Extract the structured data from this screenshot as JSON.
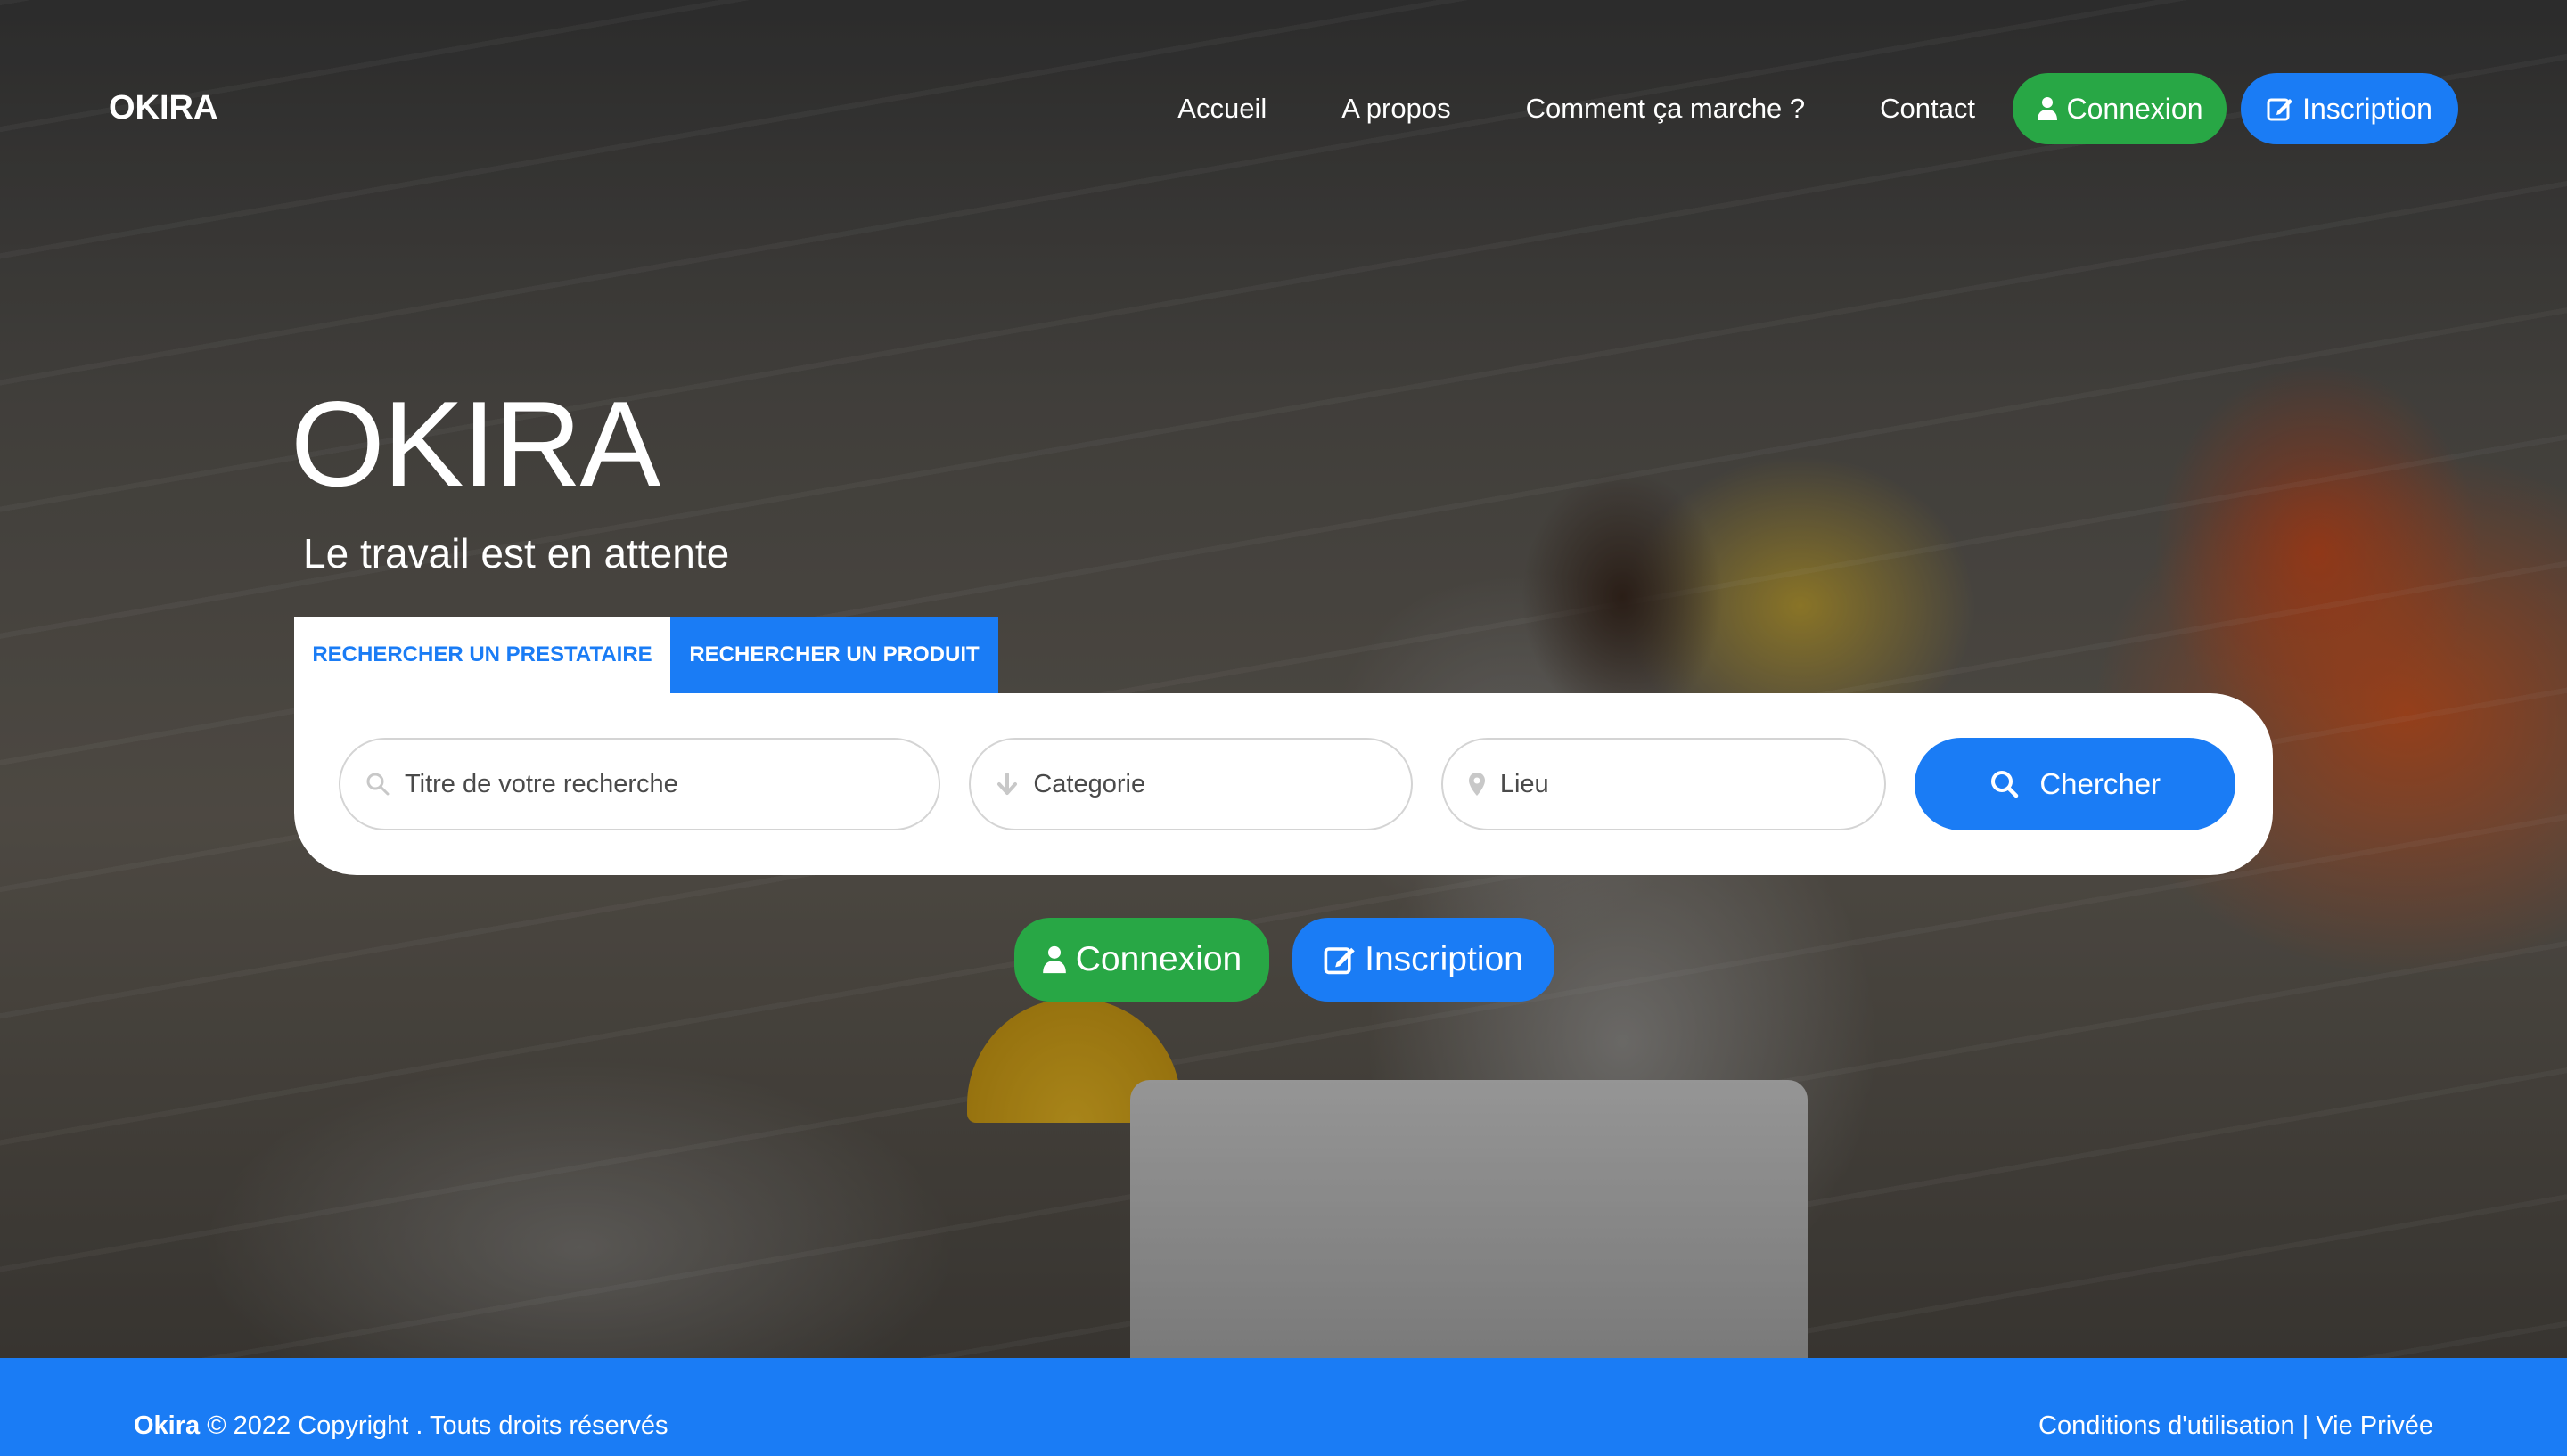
{
  "navbar": {
    "brand": "OKIRA",
    "links": [
      "Accueil",
      "A propos",
      "Comment ça marche ?",
      "Contact"
    ],
    "login_label": "Connexion",
    "signup_label": "Inscription"
  },
  "hero": {
    "title": "OKIRA",
    "subtitle": "Le travail est en attente"
  },
  "search": {
    "tabs": [
      "RECHERCHER UN PRESTATAIRE",
      "RECHERCHER UN PRODUIT"
    ],
    "active_tab": "RECHERCHER UN PRESTATAIRE",
    "title_placeholder": "Titre de votre recherche",
    "category_placeholder": "Categorie",
    "location_placeholder": "Lieu",
    "submit_label": "Chercher"
  },
  "cta": {
    "login_label": "Connexion",
    "signup_label": "Inscription"
  },
  "footer": {
    "brand": "Okira",
    "copyright": "© 2022 Copyright . Touts droits réservés",
    "terms": "Conditions d'utilisation",
    "separator": "|",
    "privacy": "Vie Privée"
  },
  "colors": {
    "primary": "#1a7cf5",
    "success": "#28a745",
    "white": "#ffffff"
  },
  "icons": {
    "login": "user-icon",
    "signup": "edit-icon",
    "search": "search-icon",
    "category": "arrow-down-icon",
    "location": "map-pin-icon"
  }
}
